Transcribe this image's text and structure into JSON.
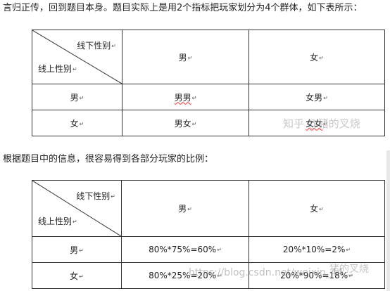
{
  "intro_text": "言归正传，回到题目本身。题目实际上是用2个指标把玩家划分为4个群体，如下表所示：",
  "middle_text": "根据题目中的信息，很容易得到各部分玩家的比例：",
  "para_mark": "↵",
  "table1": {
    "corner_offline": "线下性别",
    "corner_online": "线上性别",
    "col_headers": [
      "男",
      "女"
    ],
    "rows": [
      {
        "label": "男",
        "cells": [
          "男男",
          "女男"
        ]
      },
      {
        "label": "女",
        "cells": [
          "男女",
          "女女"
        ]
      }
    ]
  },
  "table2": {
    "corner_offline": "线下性别",
    "corner_online": "线上性别",
    "col_headers": [
      "男",
      "女"
    ],
    "rows": [
      {
        "label": "男",
        "cells": [
          "80%*75%=60%",
          "20%*10%=2%"
        ]
      },
      {
        "label": "女",
        "cells": [
          "80%*25%=20%",
          "20%*90%=18%"
        ]
      }
    ]
  },
  "watermarks": {
    "zhihu": "知乎 @猪的叉烧",
    "csdn": "https://blog.csdn.net/weixin_44...",
    "zhihu2": "猪的叉烧"
  }
}
